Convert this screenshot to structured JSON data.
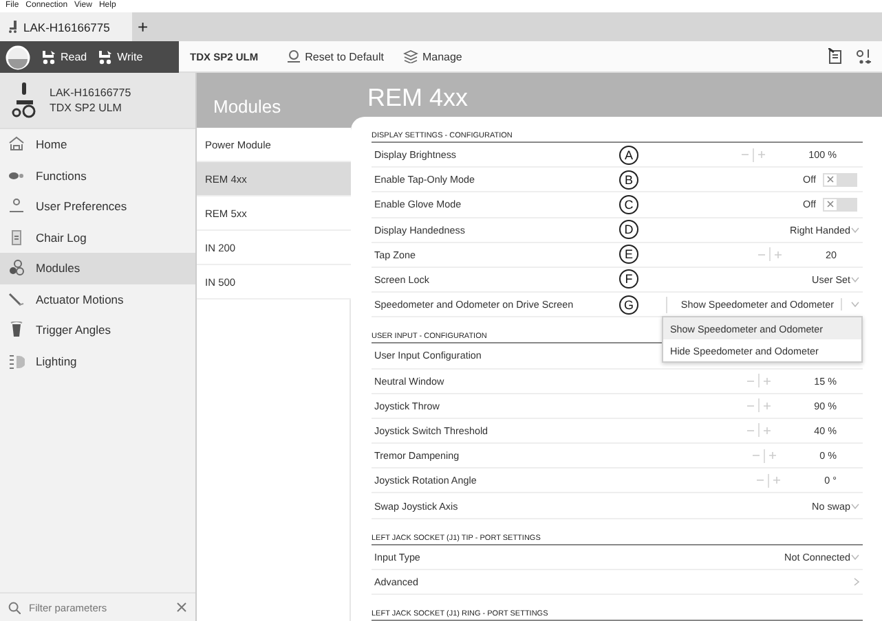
{
  "menu_bar": [
    "File",
    "Connection",
    "View",
    "Help"
  ],
  "tabs": [
    {
      "label": "LAK-H16166775",
      "selected": true
    },
    {
      "label": "+",
      "selected": false
    }
  ],
  "toolbar": {
    "read": "Read",
    "write": "Write",
    "device": "TDX SP2 ULM",
    "reset": "Reset to Default",
    "manage": "Manage"
  },
  "device": {
    "serial": "LAK-H16166775",
    "model": "TDX SP2 ULM"
  },
  "sidebar": {
    "items": [
      {
        "label": "Home",
        "selected": false
      },
      {
        "label": "Functions",
        "selected": false
      },
      {
        "label": "User Preferences",
        "selected": false
      },
      {
        "label": "Chair Log",
        "selected": false
      },
      {
        "label": "Modules",
        "selected": true
      },
      {
        "label": "Actuator Motions",
        "selected": false
      },
      {
        "label": "Trigger Angles",
        "selected": false
      },
      {
        "label": "Lighting",
        "selected": false
      }
    ],
    "filter": {
      "placeholder": "Filter parameters"
    }
  },
  "modules": {
    "title": "Modules",
    "items": [
      {
        "label": "Power Module",
        "selected": false
      },
      {
        "label": "REM 4xx",
        "selected": true
      },
      {
        "label": "REM 5xx",
        "selected": false
      },
      {
        "label": "IN 200",
        "selected": false
      },
      {
        "label": "IN 500",
        "selected": false
      }
    ]
  },
  "panel": {
    "title": "REM 4xx",
    "sections": [
      {
        "heading": "DISPLAY SETTINGS - CONFIGURATION",
        "rows": [
          {
            "label": "Display Brightness",
            "kind": "stepper",
            "value": "100 %",
            "marker": "A"
          },
          {
            "label": "Enable Tap-Only Mode",
            "kind": "toggle",
            "value": "Off",
            "on": false,
            "marker": "B"
          },
          {
            "label": "Enable Glove Mode",
            "kind": "toggle",
            "value": "Off",
            "on": false,
            "marker": "C"
          },
          {
            "label": "Display Handedness",
            "kind": "select",
            "value": "Right Handed",
            "marker": "D"
          },
          {
            "label": "Tap Zone",
            "kind": "stepper",
            "value": "20",
            "marker": "E"
          },
          {
            "label": "Screen Lock",
            "kind": "select",
            "value": "User Set",
            "marker": "F"
          },
          {
            "label": "Speedometer and Odometer on Drive Screen",
            "kind": "open-select",
            "value": "Show Speedometer and Odometer",
            "marker": "G",
            "options": [
              {
                "label": "Show Speedometer and Odometer",
                "selected": true
              },
              {
                "label": "Hide Speedometer and Odometer",
                "selected": false
              }
            ]
          }
        ]
      },
      {
        "heading": "USER INPUT - CONFIGURATION",
        "rows": [
          {
            "label": "User Input Configuration",
            "kind": "plain"
          },
          {
            "label": "Neutral Window",
            "kind": "stepper",
            "value": "15 %"
          },
          {
            "label": "Joystick Throw",
            "kind": "stepper",
            "value": "90 %"
          },
          {
            "label": "Joystick Switch Threshold",
            "kind": "stepper",
            "value": "40 %"
          },
          {
            "label": "Tremor Dampening",
            "kind": "stepper",
            "value": "0 %"
          },
          {
            "label": "Joystick Rotation Angle",
            "kind": "stepper",
            "value": "0 °"
          },
          {
            "label": "Swap Joystick Axis",
            "kind": "select",
            "value": "No swap"
          }
        ]
      },
      {
        "heading": "LEFT JACK SOCKET (J1) TIP - PORT SETTINGS",
        "rows": [
          {
            "label": "Input Type",
            "kind": "select",
            "value": "Not Connected"
          },
          {
            "label": "Advanced",
            "kind": "link"
          }
        ]
      },
      {
        "heading": "LEFT JACK SOCKET (J1) RING - PORT SETTINGS"
      }
    ]
  }
}
